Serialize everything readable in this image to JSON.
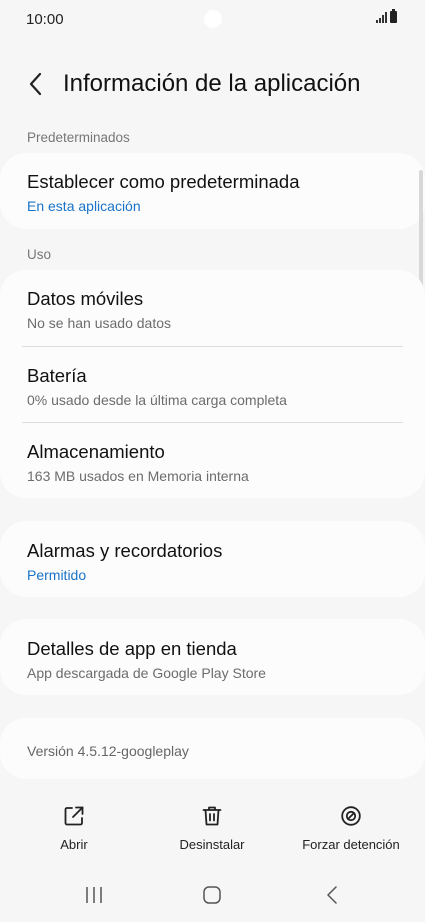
{
  "status": {
    "time": "10:00"
  },
  "header": {
    "title": "Información de la aplicación"
  },
  "sections": {
    "defaults_label": "Predeterminados",
    "usage_label": "Uso"
  },
  "defaults": {
    "title": "Establecer como predeterminada",
    "subtitle": "En esta aplicación"
  },
  "usage": {
    "mobile_data": {
      "title": "Datos móviles",
      "subtitle": "No se han usado datos"
    },
    "battery": {
      "title": "Batería",
      "subtitle": "0% usado desde la última carga completa"
    },
    "storage": {
      "title": "Almacenamiento",
      "subtitle": "163 MB usados en Memoria interna"
    }
  },
  "alarms": {
    "title": "Alarmas y recordatorios",
    "subtitle": "Permitido"
  },
  "store": {
    "title": "Detalles de app en tienda",
    "subtitle": "App descargada de Google Play Store"
  },
  "version": {
    "text": "Versión 4.5.12-googleplay"
  },
  "actions": {
    "open": "Abrir",
    "uninstall": "Desinstalar",
    "force_stop": "Forzar detención"
  },
  "icons": {
    "open": "open-external-icon",
    "uninstall": "trash-icon",
    "force_stop": "block-icon",
    "back": "chevron-left-icon"
  },
  "colors": {
    "link": "#1a73c8",
    "background": "#f6f6f6",
    "card": "#fcfcfc"
  }
}
